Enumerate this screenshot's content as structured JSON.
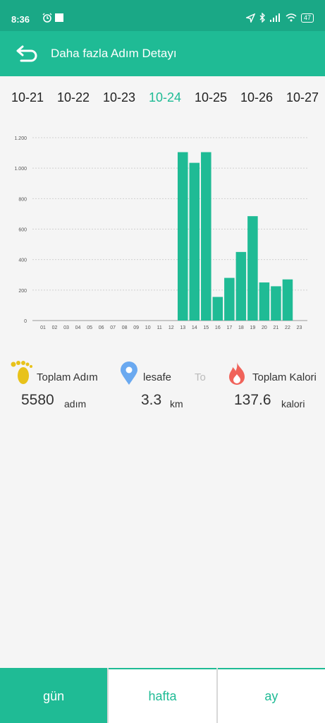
{
  "status_bar": {
    "time": "8:36",
    "battery": "47",
    "icons": [
      "alarm-icon",
      "notification-square-icon",
      "location-icon",
      "bluetooth-icon",
      "signal-icon",
      "wifi-icon",
      "battery-icon"
    ]
  },
  "header": {
    "title": "Daha fazla Adım Detayı",
    "back_icon": "back-arrow-icon",
    "background": "#1fbb95"
  },
  "dates": [
    {
      "label": "10-21",
      "active": false
    },
    {
      "label": "10-22",
      "active": false
    },
    {
      "label": "10-23",
      "active": false
    },
    {
      "label": "10-24",
      "active": true
    },
    {
      "label": "10-25",
      "active": false
    },
    {
      "label": "10-26",
      "active": false
    },
    {
      "label": "10-27",
      "active": false
    }
  ],
  "chart_data": {
    "type": "bar",
    "categories": [
      "01",
      "02",
      "03",
      "04",
      "05",
      "06",
      "07",
      "08",
      "09",
      "10",
      "11",
      "12",
      "13",
      "14",
      "15",
      "16",
      "17",
      "18",
      "19",
      "20",
      "21",
      "22",
      "23"
    ],
    "values": [
      0,
      0,
      0,
      0,
      0,
      0,
      0,
      0,
      0,
      0,
      0,
      0,
      1105,
      1035,
      1105,
      155,
      280,
      450,
      685,
      250,
      225,
      270,
      0
    ],
    "ylim": [
      0,
      1200
    ],
    "yticks": [
      "0",
      "200",
      "400",
      "600",
      "800",
      "1.000",
      "1.200"
    ],
    "ytick_values": [
      0,
      200,
      400,
      600,
      800,
      1000,
      1200
    ],
    "grid": true,
    "bar_color": "#1fbb95",
    "title": "",
    "xlabel": "",
    "ylabel": ""
  },
  "stats": {
    "steps": {
      "label": "Toplam Adım",
      "value": "5580",
      "unit": "adım",
      "icon": "footprint-icon"
    },
    "distance": {
      "label": "lesafe",
      "label_overflow": "To",
      "value": "3.3",
      "unit": "km",
      "icon": "location-pin-icon"
    },
    "calories": {
      "label": "Toplam Kalori",
      "value": "137.6",
      "unit": "kalori",
      "icon": "flame-icon"
    }
  },
  "tabs": [
    {
      "label": "gün",
      "active": true
    },
    {
      "label": "hafta",
      "active": false
    },
    {
      "label": "ay",
      "active": false
    }
  ]
}
